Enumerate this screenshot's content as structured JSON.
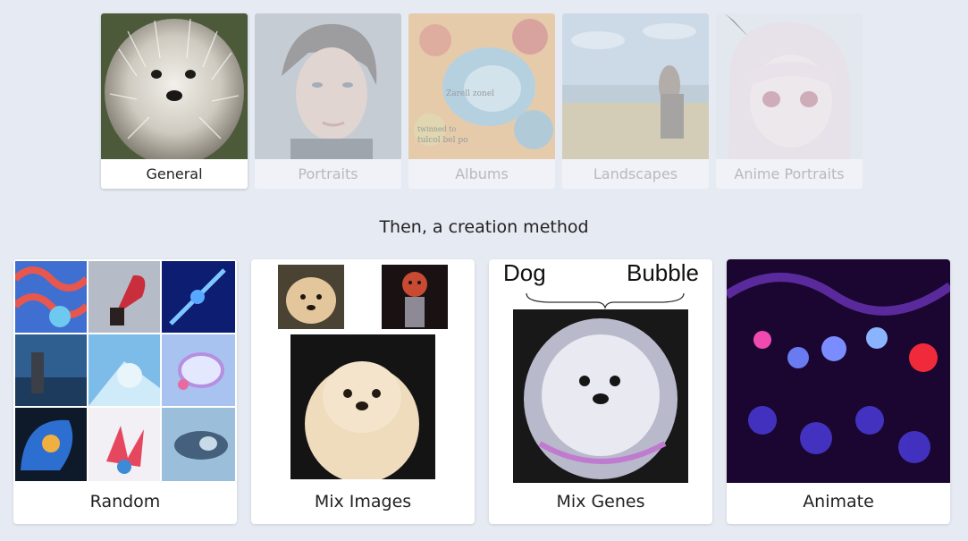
{
  "categories": [
    {
      "label": "General",
      "active": true
    },
    {
      "label": "Portraits",
      "active": false
    },
    {
      "label": "Albums",
      "active": false
    },
    {
      "label": "Landscapes",
      "active": false
    },
    {
      "label": "Anime Portraits",
      "active": false
    }
  ],
  "heading": "Then, a creation method",
  "methods": [
    {
      "label": "Random"
    },
    {
      "label": "Mix Images"
    },
    {
      "label": "Mix Genes",
      "gene_a": "Dog",
      "gene_b": "Bubble"
    },
    {
      "label": "Animate"
    }
  ],
  "album_text": [
    "Zarell zonel",
    "twinned to",
    "tulcol bel po"
  ],
  "colors": {
    "background": "#e6eaf2",
    "card": "#ffffff",
    "text": "#222222"
  }
}
